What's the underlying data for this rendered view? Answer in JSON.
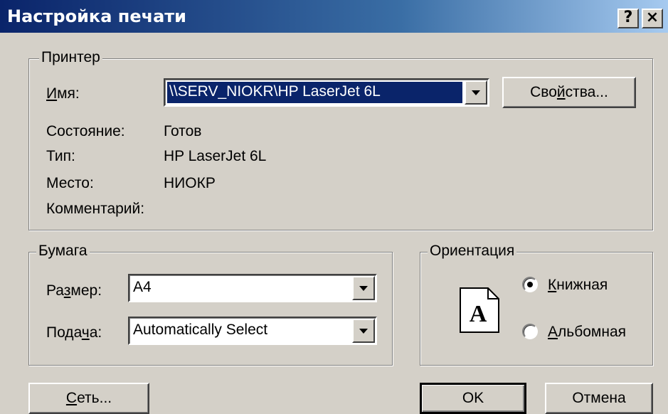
{
  "window": {
    "title": "Настройка печати",
    "help_label": "?",
    "close_label": "×"
  },
  "printer": {
    "group_label": "Принтер",
    "name_label_underlined": "И",
    "name_label_rest": "мя:",
    "name_value": "\\\\SERV_NIOKR\\HP LaserJet 6L",
    "properties_pre": "Сво",
    "properties_underlined": "й",
    "properties_post": "ства...",
    "status_label": "Состояние:",
    "status_value": "Готов",
    "type_label": "Тип:",
    "type_value": "HP LaserJet 6L",
    "location_label": "Место:",
    "location_value": "НИОКР",
    "comment_label": "Комментарий:",
    "comment_value": ""
  },
  "paper": {
    "group_label": "Бумага",
    "size_pre": "Ра",
    "size_underlined": "з",
    "size_post": "мер:",
    "size_value": "A4",
    "source_pre": "Пода",
    "source_underlined": "ч",
    "source_post": "а:",
    "source_value": "Automatically Select"
  },
  "orientation": {
    "group_label": "Ориентация",
    "portrait_underlined": "К",
    "portrait_rest": "нижная",
    "portrait_checked": true,
    "landscape_underlined": "А",
    "landscape_rest": "льбомная",
    "landscape_checked": false,
    "page_icon_letter": "A"
  },
  "buttons": {
    "network_underlined": "С",
    "network_rest": "еть...",
    "ok_label": "OK",
    "cancel_label": "Отмена"
  }
}
